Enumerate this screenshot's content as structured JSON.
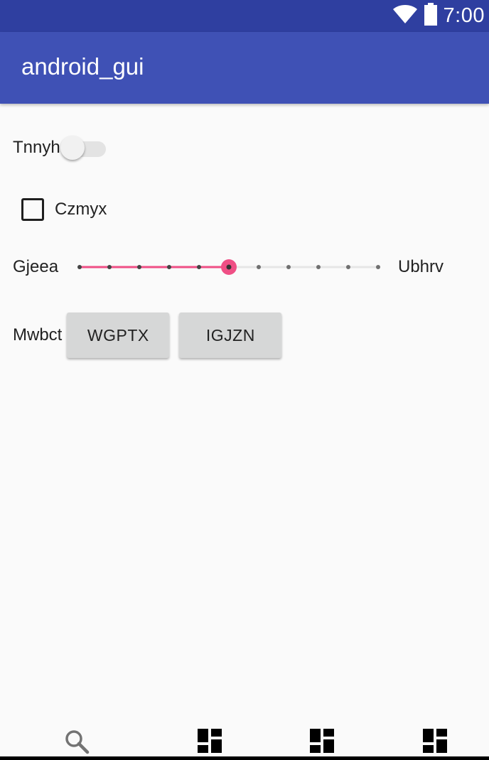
{
  "status_bar": {
    "time": "7:00",
    "icons": [
      "wifi-icon",
      "battery-icon"
    ],
    "background": "#2f3fa0"
  },
  "app_bar": {
    "title": "android_gui",
    "background": "#3f51b5"
  },
  "switch_row": {
    "label": "Tnnyh",
    "checked": false
  },
  "checkbox_row": {
    "label": "Czmyx",
    "checked": false
  },
  "slider_row": {
    "left_label": "Gjeea",
    "right_label": "Ubhrv",
    "value": 5,
    "max": 10,
    "accent": "#ef4f85"
  },
  "button_row": {
    "label": "Mwbct",
    "buttons": [
      "WGPTX",
      "IGJZN"
    ]
  },
  "bottom_nav": {
    "items": [
      "search-icon",
      "dashboard-icon",
      "dashboard-icon",
      "dashboard-icon"
    ]
  }
}
